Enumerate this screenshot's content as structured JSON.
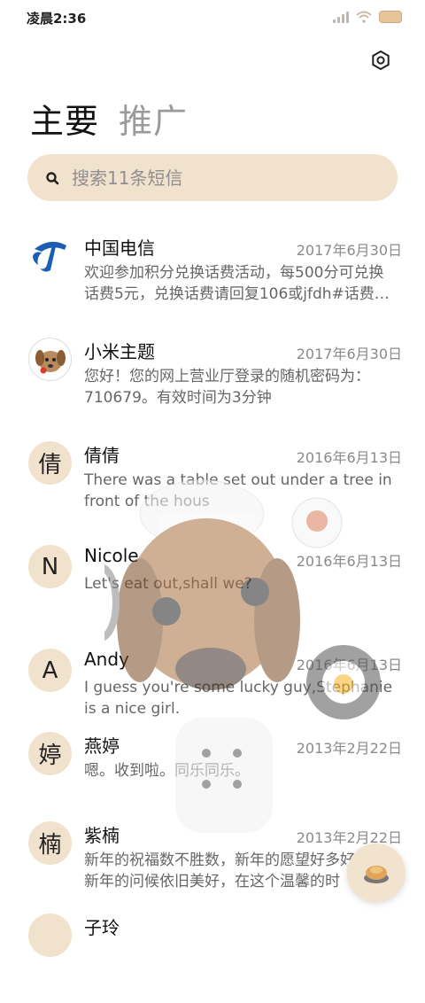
{
  "status": {
    "time": "凌晨2:36"
  },
  "tabs": [
    {
      "label": "主要"
    },
    {
      "label": "推广"
    }
  ],
  "search": {
    "placeholder": "搜索11条短信",
    "value": ""
  },
  "conversations": [
    {
      "sender": "中国电信",
      "date": "2017年6月30日",
      "preview": "欢迎参加积分兑换话费活动，每500分可兑换话费5元，兑换话费请回复106或jfdh#话费…",
      "avatar": "china-telecom-logo"
    },
    {
      "sender": "小米主题",
      "date": "2017年6月30日",
      "preview": "您好！您的网上营业厅登录的随机密码为：710679。有效时间为3分钟",
      "avatar": "puppy-photo"
    },
    {
      "sender": "倩倩",
      "date": "2016年6月13日",
      "preview": "There was a table set out under a tree in front of the hous",
      "avatar_text": "倩"
    },
    {
      "sender": "Nicole",
      "date": "2016年6月13日",
      "preview": "Let's eat out,shall we?",
      "avatar_text": "N"
    },
    {
      "sender": "Andy",
      "date": "2016年6月13日",
      "preview": "I guess you're some lucky guy,Stephanie is a nice girl.",
      "avatar_text": "A"
    },
    {
      "sender": "燕婷",
      "date": "2013年2月22日",
      "preview": "嗯。收到啦。同乐同乐。",
      "avatar_text": "婷"
    },
    {
      "sender": "紫楠",
      "date": "2013年2月22日",
      "preview": "新年的祝福数不胜数，新年的愿望好多好多，新年的问候依旧美好，在这个温馨的时",
      "avatar_text": "楠"
    },
    {
      "sender": "子玲",
      "date": "",
      "preview": "",
      "avatar_text": ""
    }
  ],
  "colors": {
    "accent": "#f1e2cd",
    "telecom_blue": "#1a5fb4"
  }
}
